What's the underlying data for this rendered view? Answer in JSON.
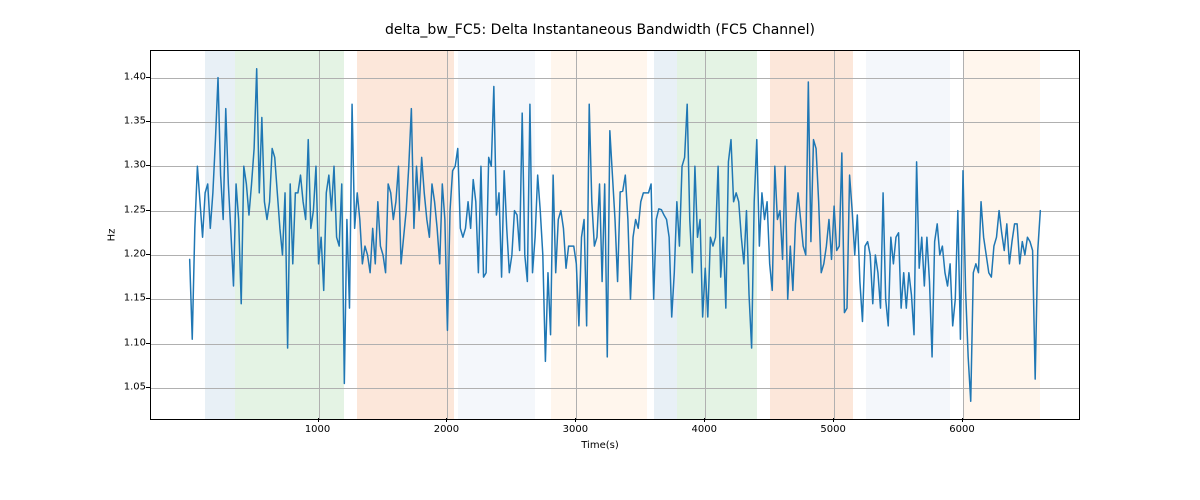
{
  "chart_data": {
    "type": "line",
    "title": "delta_bw_FC5: Delta Instantaneous Bandwidth (FC5 Channel)",
    "xlabel": "Time(s)",
    "ylabel": "Hz",
    "xlim": [
      -300,
      6900
    ],
    "ylim": [
      1.015,
      1.43
    ],
    "xticks": [
      1000,
      2000,
      3000,
      4000,
      5000,
      6000
    ],
    "yticks": [
      1.05,
      1.1,
      1.15,
      1.2,
      1.25,
      1.3,
      1.35,
      1.4
    ],
    "ytick_labels": [
      "1.05",
      "1.10",
      "1.15",
      "1.20",
      "1.25",
      "1.30",
      "1.35",
      "1.40"
    ],
    "bands": [
      {
        "x0": 120,
        "x1": 350,
        "color": "#b3cde0"
      },
      {
        "x0": 350,
        "x1": 1200,
        "color": "#a6d8a6"
      },
      {
        "x0": 1300,
        "x1": 2050,
        "color": "#f4b183"
      },
      {
        "x0": 2080,
        "x1": 2680,
        "color": "#d9e6f2"
      },
      {
        "x0": 2800,
        "x1": 2900,
        "color": "#ffe0c2"
      },
      {
        "x0": 2900,
        "x1": 3550,
        "color": "#ffe0c2"
      },
      {
        "x0": 3600,
        "x1": 3780,
        "color": "#b3cde0"
      },
      {
        "x0": 3780,
        "x1": 4400,
        "color": "#a6d8a6"
      },
      {
        "x0": 4500,
        "x1": 5150,
        "color": "#f4b183"
      },
      {
        "x0": 5250,
        "x1": 5900,
        "color": "#d9e6f2"
      },
      {
        "x0": 6000,
        "x1": 6600,
        "color": "#ffe0c2"
      }
    ],
    "x": [
      0,
      20,
      40,
      60,
      80,
      100,
      120,
      140,
      160,
      180,
      200,
      220,
      240,
      260,
      280,
      300,
      320,
      340,
      360,
      380,
      400,
      420,
      440,
      460,
      480,
      500,
      520,
      540,
      560,
      580,
      600,
      620,
      640,
      660,
      680,
      700,
      720,
      740,
      760,
      780,
      800,
      820,
      840,
      860,
      880,
      900,
      920,
      940,
      960,
      980,
      1000,
      1020,
      1040,
      1060,
      1080,
      1100,
      1120,
      1140,
      1160,
      1180,
      1200,
      1220,
      1240,
      1260,
      1280,
      1300,
      1320,
      1340,
      1360,
      1380,
      1400,
      1420,
      1440,
      1460,
      1480,
      1500,
      1520,
      1540,
      1560,
      1580,
      1600,
      1620,
      1640,
      1660,
      1680,
      1700,
      1720,
      1740,
      1760,
      1780,
      1800,
      1820,
      1840,
      1860,
      1880,
      1900,
      1920,
      1940,
      1960,
      1980,
      2000,
      2020,
      2040,
      2060,
      2080,
      2100,
      2120,
      2140,
      2160,
      2180,
      2200,
      2220,
      2240,
      2260,
      2280,
      2300,
      2320,
      2340,
      2360,
      2380,
      2400,
      2420,
      2440,
      2460,
      2480,
      2500,
      2520,
      2540,
      2560,
      2580,
      2600,
      2620,
      2640,
      2660,
      2680,
      2700,
      2720,
      2740,
      2760,
      2780,
      2800,
      2820,
      2840,
      2860,
      2880,
      2900,
      2920,
      2940,
      2960,
      2980,
      3000,
      3020,
      3040,
      3060,
      3080,
      3100,
      3120,
      3140,
      3160,
      3180,
      3200,
      3220,
      3240,
      3260,
      3280,
      3300,
      3320,
      3340,
      3360,
      3380,
      3400,
      3420,
      3440,
      3460,
      3480,
      3500,
      3520,
      3540,
      3560,
      3580,
      3600,
      3620,
      3640,
      3660,
      3680,
      3700,
      3720,
      3740,
      3760,
      3780,
      3800,
      3820,
      3840,
      3860,
      3880,
      3900,
      3920,
      3940,
      3960,
      3980,
      4000,
      4020,
      4040,
      4060,
      4080,
      4100,
      4120,
      4140,
      4160,
      4180,
      4200,
      4220,
      4240,
      4260,
      4280,
      4300,
      4320,
      4340,
      4360,
      4380,
      4400,
      4420,
      4440,
      4460,
      4480,
      4500,
      4520,
      4540,
      4560,
      4580,
      4600,
      4620,
      4640,
      4660,
      4680,
      4700,
      4720,
      4740,
      4760,
      4780,
      4800,
      4820,
      4840,
      4860,
      4880,
      4900,
      4920,
      4940,
      4960,
      4980,
      5000,
      5020,
      5040,
      5060,
      5080,
      5100,
      5120,
      5140,
      5160,
      5180,
      5200,
      5220,
      5240,
      5260,
      5280,
      5300,
      5320,
      5340,
      5360,
      5380,
      5400,
      5420,
      5440,
      5460,
      5480,
      5500,
      5520,
      5540,
      5560,
      5580,
      5600,
      5620,
      5640,
      5660,
      5680,
      5700,
      5720,
      5740,
      5760,
      5780,
      5800,
      5820,
      5840,
      5860,
      5880,
      5900,
      5920,
      5940,
      5960,
      5980,
      6000,
      6020,
      6040,
      6060,
      6080,
      6100,
      6120,
      6140,
      6160,
      6180,
      6200,
      6220,
      6240,
      6260,
      6280,
      6300,
      6320,
      6340,
      6360,
      6380,
      6400,
      6420,
      6440,
      6460,
      6480,
      6500,
      6520,
      6540,
      6560,
      6580,
      6600
    ],
    "y": [
      1.195,
      1.105,
      1.23,
      1.3,
      1.26,
      1.22,
      1.27,
      1.28,
      1.23,
      1.27,
      1.33,
      1.4,
      1.29,
      1.24,
      1.365,
      1.28,
      1.225,
      1.165,
      1.28,
      1.24,
      1.145,
      1.3,
      1.28,
      1.245,
      1.28,
      1.32,
      1.41,
      1.27,
      1.355,
      1.26,
      1.24,
      1.26,
      1.32,
      1.31,
      1.27,
      1.23,
      1.2,
      1.27,
      1.095,
      1.28,
      1.19,
      1.27,
      1.27,
      1.29,
      1.26,
      1.24,
      1.33,
      1.23,
      1.25,
      1.3,
      1.19,
      1.22,
      1.16,
      1.27,
      1.29,
      1.25,
      1.3,
      1.22,
      1.21,
      1.28,
      1.055,
      1.24,
      1.14,
      1.37,
      1.23,
      1.27,
      1.24,
      1.19,
      1.21,
      1.2,
      1.18,
      1.23,
      1.19,
      1.26,
      1.21,
      1.2,
      1.18,
      1.28,
      1.27,
      1.24,
      1.26,
      1.3,
      1.19,
      1.22,
      1.25,
      1.3,
      1.365,
      1.23,
      1.3,
      1.25,
      1.31,
      1.27,
      1.24,
      1.22,
      1.28,
      1.26,
      1.23,
      1.19,
      1.28,
      1.24,
      1.115,
      1.25,
      1.295,
      1.3,
      1.32,
      1.23,
      1.22,
      1.23,
      1.26,
      1.23,
      1.285,
      1.26,
      1.18,
      1.3,
      1.175,
      1.18,
      1.31,
      1.3,
      1.39,
      1.245,
      1.27,
      1.175,
      1.295,
      1.23,
      1.18,
      1.2,
      1.25,
      1.245,
      1.205,
      1.36,
      1.2,
      1.17,
      1.37,
      1.18,
      1.22,
      1.29,
      1.25,
      1.2,
      1.08,
      1.18,
      1.11,
      1.29,
      1.18,
      1.24,
      1.25,
      1.23,
      1.185,
      1.21,
      1.21,
      1.21,
      1.19,
      1.12,
      1.22,
      1.24,
      1.12,
      1.37,
      1.26,
      1.21,
      1.22,
      1.28,
      1.17,
      1.28,
      1.085,
      1.34,
      1.29,
      1.24,
      1.17,
      1.271,
      1.272,
      1.29,
      1.24,
      1.15,
      1.22,
      1.24,
      1.23,
      1.26,
      1.27,
      1.27,
      1.27,
      1.28,
      1.15,
      1.24,
      1.252,
      1.251,
      1.245,
      1.24,
      1.22,
      1.13,
      1.18,
      1.26,
      1.21,
      1.3,
      1.31,
      1.37,
      1.24,
      1.18,
      1.3,
      1.22,
      1.24,
      1.13,
      1.185,
      1.13,
      1.22,
      1.21,
      1.22,
      1.3,
      1.175,
      1.22,
      1.14,
      1.305,
      1.33,
      1.26,
      1.27,
      1.26,
      1.22,
      1.19,
      1.25,
      1.155,
      1.095,
      1.26,
      1.33,
      1.21,
      1.27,
      1.24,
      1.26,
      1.19,
      1.16,
      1.3,
      1.24,
      1.25,
      1.195,
      1.3,
      1.15,
      1.21,
      1.16,
      1.235,
      1.27,
      1.24,
      1.21,
      1.2,
      1.395,
      1.215,
      1.33,
      1.32,
      1.26,
      1.18,
      1.19,
      1.21,
      1.24,
      1.195,
      1.255,
      1.205,
      1.21,
      1.315,
      1.135,
      1.14,
      1.29,
      1.25,
      1.2,
      1.245,
      1.17,
      1.125,
      1.21,
      1.215,
      1.2,
      1.145,
      1.2,
      1.18,
      1.14,
      1.27,
      1.15,
      1.12,
      1.22,
      1.19,
      1.22,
      1.225,
      1.14,
      1.18,
      1.14,
      1.18,
      1.155,
      1.11,
      1.305,
      1.185,
      1.22,
      1.165,
      1.22,
      1.17,
      1.085,
      1.215,
      1.235,
      1.2,
      1.21,
      1.18,
      1.165,
      1.19,
      1.12,
      1.15,
      1.25,
      1.105,
      1.295,
      1.16,
      1.085,
      1.035,
      1.18,
      1.19,
      1.18,
      1.26,
      1.22,
      1.2,
      1.18,
      1.175,
      1.21,
      1.22,
      1.25,
      1.225,
      1.205,
      1.235,
      1.19,
      1.215,
      1.235,
      1.235,
      1.19,
      1.215,
      1.2,
      1.22,
      1.215,
      1.205,
      1.06,
      1.205,
      1.25
    ]
  }
}
